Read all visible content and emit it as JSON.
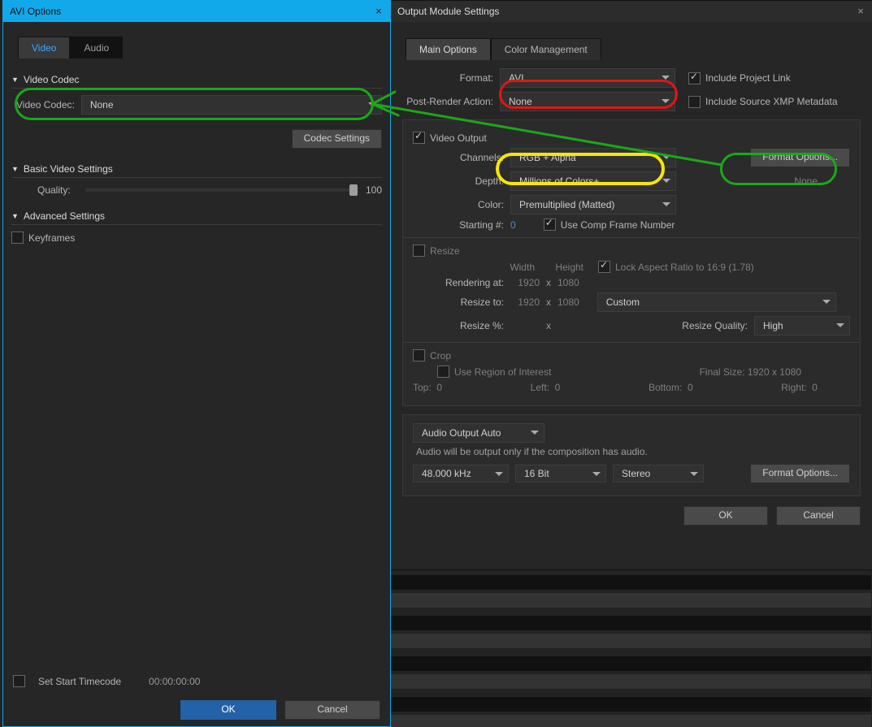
{
  "avi": {
    "title": "AVI Options",
    "tabs": {
      "video": "Video",
      "audio": "Audio"
    },
    "section_codec": "Video Codec",
    "codec_label": "Video Codec:",
    "codec_value": "None",
    "codec_settings_btn": "Codec Settings",
    "section_basic": "Basic Video Settings",
    "quality_label": "Quality:",
    "quality_value": "100",
    "section_adv": "Advanced Settings",
    "keyframes": "Keyframes",
    "start_tc": "Set Start Timecode",
    "start_tc_value": "00:00:00:00",
    "ok": "OK",
    "cancel": "Cancel"
  },
  "om": {
    "title": "Output Module Settings",
    "tab_main": "Main Options",
    "tab_color": "Color Management",
    "format_label": "Format:",
    "format_value": "AVI",
    "include_project": "Include Project Link",
    "post_render_label": "Post-Render Action:",
    "post_render_value": "None",
    "include_xmp": "Include Source XMP Metadata",
    "video_output": "Video Output",
    "channels_label": "Channels:",
    "channels_value": "RGB + Alpha",
    "format_options_btn": "Format Options...",
    "depth_label": "Depth:",
    "depth_value": "Millions of Colors+",
    "fo_status": "None",
    "color_label": "Color:",
    "color_value": "Premultiplied (Matted)",
    "start_num_label": "Starting #:",
    "start_num_value": "0",
    "use_comp": "Use Comp Frame Number",
    "resize_label": "Resize",
    "width": "Width",
    "height": "Height",
    "lock_aspect": "Lock Aspect Ratio to 16:9 (1.78)",
    "rendering_at": "Rendering at:",
    "resize_to": "Resize to:",
    "resize_pct": "Resize %:",
    "r_w": "1920",
    "r_h": "1080",
    "rt_w": "1920",
    "rt_h": "1080",
    "resize_to_preset": "Custom",
    "resize_quality_label": "Resize Quality:",
    "resize_quality_value": "High",
    "crop_label": "Crop",
    "use_roi": "Use Region of Interest",
    "final_size": "Final Size: 1920 x 1080",
    "top": "Top:",
    "left": "Left:",
    "bottom": "Bottom:",
    "right": "Right:",
    "zero": "0",
    "audio_mode": "Audio Output Auto",
    "audio_note": "Audio will be output only if the composition has audio.",
    "a_rate": "48.000 kHz",
    "a_bit": "16 Bit",
    "a_ch": "Stereo",
    "a_format_options": "Format Options...",
    "ok": "OK",
    "cancel": "Cancel"
  }
}
